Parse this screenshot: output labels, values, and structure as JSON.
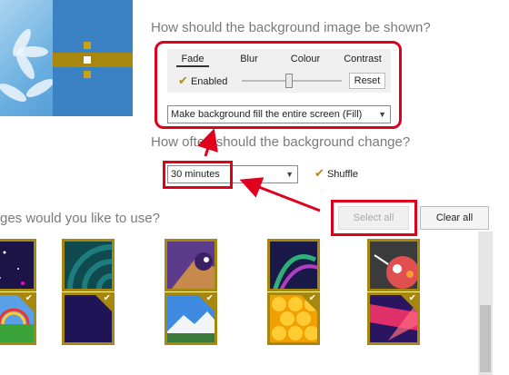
{
  "headings": {
    "display": "How should the background image be shown?",
    "frequency": "How often should the background change?",
    "images": "ges would you like to use?"
  },
  "effects": {
    "tabs": [
      "Fade",
      "Blur",
      "Colour",
      "Contrast"
    ],
    "active_tab": "Fade",
    "enabled_label": "Enabled",
    "fade_level_percent": 60,
    "reset_label": "Reset"
  },
  "fill_select": {
    "value": "Make background fill the entire screen (Fill)"
  },
  "interval_select": {
    "value": "30 minutes"
  },
  "shuffle": {
    "label": "Shuffle",
    "checked": true
  },
  "buttons": {
    "select_all": "Select all",
    "clear_all": "Clear all"
  },
  "colors": {
    "accent": "#a8870e",
    "highlight": "#e0001b"
  },
  "images": {
    "row1": [
      "stars-dark",
      "teal-swirl",
      "purple-bird",
      "dark-swirl",
      "robot-face"
    ],
    "row2": [
      "rainbow-landscape",
      "navy-plain",
      "mountain-lake",
      "honeycomb",
      "abstract-shapes"
    ]
  }
}
